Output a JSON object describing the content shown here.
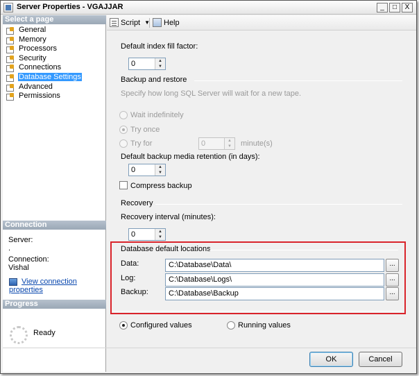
{
  "window": {
    "title": "Server Properties - VGAJJAR",
    "buttons": [
      "_",
      "□",
      "X"
    ]
  },
  "left": {
    "select_page_header": "Select a page",
    "pages": [
      {
        "label": "General"
      },
      {
        "label": "Memory"
      },
      {
        "label": "Processors"
      },
      {
        "label": "Security"
      },
      {
        "label": "Connections"
      },
      {
        "label": "Database Settings",
        "selected": true
      },
      {
        "label": "Advanced"
      },
      {
        "label": "Permissions"
      }
    ],
    "connection_header": "Connection",
    "server_label": "Server:",
    "server_value": ".",
    "connection_label": "Connection:",
    "connection_value": "Vishal",
    "view_link": "View connection properties",
    "progress_header": "Progress",
    "progress_status": "Ready"
  },
  "toolbar": {
    "script_label": "Script",
    "help_label": "Help"
  },
  "settings": {
    "fill_factor_label": "Default index fill factor:",
    "fill_factor_value": "0",
    "backup_group": "Backup and restore",
    "backup_desc": "Specify how long SQL Server will wait for a new tape.",
    "wait_indefinitely": "Wait indefinitely",
    "try_once": "Try once",
    "try_for": "Try for",
    "try_for_value": "0",
    "minutes_unit": "minute(s)",
    "retention_label": "Default backup media retention (in days):",
    "retention_value": "0",
    "compress_label": "Compress backup",
    "recovery_group": "Recovery",
    "recovery_interval_label": "Recovery interval (minutes):",
    "recovery_interval_value": "0",
    "locations_group": "Database default locations",
    "data_label": "Data:",
    "data_value": "C:\\Database\\Data\\",
    "log_label": "Log:",
    "log_value": "C:\\Database\\Logs\\",
    "backup_label": "Backup:",
    "backup_value": "C:\\Database\\Backup",
    "browse": "...",
    "configured_values": "Configured values",
    "running_values": "Running values"
  },
  "footer": {
    "ok": "OK",
    "cancel": "Cancel"
  },
  "colors": {
    "highlight_box": "#d9232a",
    "selection": "#3399ff"
  }
}
